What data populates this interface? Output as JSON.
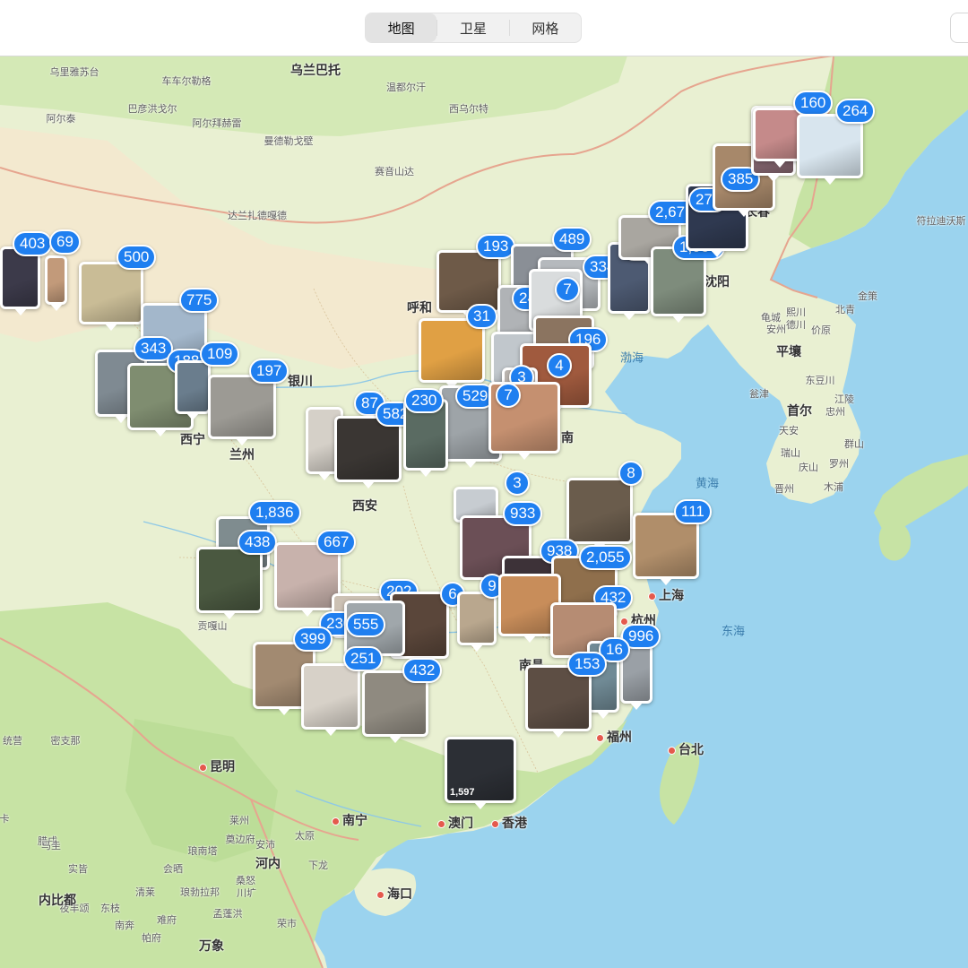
{
  "toolbar": {
    "segments": [
      "地图",
      "卫星",
      "网格"
    ],
    "active_segment": "地图"
  },
  "colors": {
    "land": "#e9f0d2",
    "forest": "#c7e3a4",
    "desert": "#f3e9cf",
    "water": "#9bd3ee",
    "border": "#e6a58f",
    "badge": "#1f7ff0",
    "city_dot": "#e45a4d"
  },
  "map_labels": [
    {
      "text": "乌里雅苏台",
      "type": "town"
    },
    {
      "text": "乌兰巴托",
      "type": "city"
    },
    {
      "text": "车车尔勒格",
      "type": "town"
    },
    {
      "text": "温都尔汗",
      "type": "town"
    },
    {
      "text": "巴彦洪戈尔",
      "type": "town"
    },
    {
      "text": "西乌尔特",
      "type": "town"
    },
    {
      "text": "阿尔泰",
      "type": "town"
    },
    {
      "text": "阿尔拜赫雷",
      "type": "town"
    },
    {
      "text": "曼德勒戈壁",
      "type": "town"
    },
    {
      "text": "赛音山达",
      "type": "town"
    },
    {
      "text": "达兰扎德嘎德",
      "type": "town"
    },
    {
      "text": "符拉迪沃斯",
      "type": "town"
    },
    {
      "text": "呼和",
      "type": "city"
    },
    {
      "text": "银川",
      "type": "city"
    },
    {
      "text": "西宁",
      "type": "city"
    },
    {
      "text": "兰州",
      "type": "city"
    },
    {
      "text": "西安",
      "type": "city"
    },
    {
      "text": "贡嘎山",
      "type": "town"
    },
    {
      "text": "昆明",
      "type": "city"
    },
    {
      "text": "南宁",
      "type": "city"
    },
    {
      "text": "澳门",
      "type": "city"
    },
    {
      "text": "香港",
      "type": "city"
    },
    {
      "text": "海口",
      "type": "city"
    },
    {
      "text": "上海",
      "type": "city"
    },
    {
      "text": "杭州",
      "type": "city"
    },
    {
      "text": "福州",
      "type": "city"
    },
    {
      "text": "台北",
      "type": "city"
    },
    {
      "text": "南",
      "type": "city"
    },
    {
      "text": "南昌",
      "type": "city"
    },
    {
      "text": "沈阳",
      "type": "city"
    },
    {
      "text": "长春",
      "type": "city"
    },
    {
      "text": "渤海",
      "type": "sea"
    },
    {
      "text": "黄海",
      "type": "sea"
    },
    {
      "text": "东海",
      "type": "sea"
    },
    {
      "text": "平壤",
      "type": "city"
    },
    {
      "text": "首尔",
      "type": "city"
    },
    {
      "text": "金策",
      "type": "town"
    },
    {
      "text": "北青",
      "type": "town"
    },
    {
      "text": "龟城",
      "type": "town"
    },
    {
      "text": "熙川",
      "type": "town"
    },
    {
      "text": "德川",
      "type": "town"
    },
    {
      "text": "安州",
      "type": "town"
    },
    {
      "text": "价原",
      "type": "town"
    },
    {
      "text": "东豆川",
      "type": "town"
    },
    {
      "text": "瓮津",
      "type": "town"
    },
    {
      "text": "江陵",
      "type": "town"
    },
    {
      "text": "忠州",
      "type": "town"
    },
    {
      "text": "天安",
      "type": "town"
    },
    {
      "text": "瑞山",
      "type": "town"
    },
    {
      "text": "群山",
      "type": "town"
    },
    {
      "text": "庆山",
      "type": "town"
    },
    {
      "text": "罗州",
      "type": "town"
    },
    {
      "text": "晋州",
      "type": "town"
    },
    {
      "text": "木浦",
      "type": "town"
    },
    {
      "text": "统营",
      "type": "town"
    },
    {
      "text": "密支那",
      "type": "town"
    },
    {
      "text": "莱州",
      "type": "town"
    },
    {
      "text": "奠边府",
      "type": "town"
    },
    {
      "text": "安沛",
      "type": "town"
    },
    {
      "text": "太原",
      "type": "town"
    },
    {
      "text": "琅南塔",
      "type": "town"
    },
    {
      "text": "河内",
      "type": "city"
    },
    {
      "text": "下龙",
      "type": "town"
    },
    {
      "text": "会晒",
      "type": "town"
    },
    {
      "text": "桑怒",
      "type": "town"
    },
    {
      "text": "清莱",
      "type": "town"
    },
    {
      "text": "琅勃拉邦",
      "type": "town"
    },
    {
      "text": "川圹",
      "type": "town"
    },
    {
      "text": "孟蓬洪",
      "type": "town"
    },
    {
      "text": "夜丰颂",
      "type": "town"
    },
    {
      "text": "南奔",
      "type": "town"
    },
    {
      "text": "难府",
      "type": "town"
    },
    {
      "text": "帕府",
      "type": "town"
    },
    {
      "text": "万象",
      "type": "city"
    },
    {
      "text": "荣市",
      "type": "town"
    },
    {
      "text": "内比都",
      "type": "city"
    },
    {
      "text": "东枝",
      "type": "town"
    },
    {
      "text": "腊戌",
      "type": "town"
    },
    {
      "text": "实皆",
      "type": "town"
    },
    {
      "text": "马圭",
      "type": "town"
    },
    {
      "text": "卡",
      "type": "town"
    }
  ],
  "photo_clusters": [
    {
      "count": "403",
      "color": "#3c3a4a"
    },
    {
      "count": "69",
      "color": "#c29a7a"
    },
    {
      "count": "500",
      "color": "#c9bc96"
    },
    {
      "count": "775",
      "color": "#a3b7cb"
    },
    {
      "count": "343",
      "color": "#7f8a92"
    },
    {
      "count": "188",
      "color": "#7f8d70"
    },
    {
      "count": "109",
      "color": "#6a7d8d"
    },
    {
      "count": "197",
      "color": "#9c9a94"
    },
    {
      "count": "193",
      "color": "#6e5a48"
    },
    {
      "count": "489",
      "color": "#8a8f96"
    },
    {
      "count": "334",
      "color": "#b5b9bd"
    },
    {
      "count": "643",
      "color": "#4d5a72"
    },
    {
      "count": "2,676",
      "color": "#a9a6a0"
    },
    {
      "count": "1,067",
      "color": "#7e8c7c"
    },
    {
      "count": "279",
      "color": "#2f3950"
    },
    {
      "count": "385",
      "color": "#a7886a"
    },
    {
      "count": "3",
      "color": "#8a6a74"
    },
    {
      "count": "160",
      "color": "#c58a8a"
    },
    {
      "count": "264",
      "color": "#d8e5ee"
    },
    {
      "count": "24",
      "color": "#b0b3b6"
    },
    {
      "count": "7",
      "color": "#d9dcdd"
    },
    {
      "count": "31",
      "color": "#e0a044"
    },
    {
      "count": "5",
      "color": "#c1c7cc"
    },
    {
      "count": "196",
      "color": "#8b7460"
    },
    {
      "count": "4",
      "color": "#a05a3e"
    },
    {
      "count": "3",
      "color": "#b8b2ad"
    },
    {
      "count": "529",
      "color": "#9ea4a8"
    },
    {
      "count": "7",
      "color": "#c59070"
    },
    {
      "count": "87",
      "color": "#d5d0c8"
    },
    {
      "count": "582",
      "color": "#3a3633"
    },
    {
      "count": "230",
      "color": "#5a6b62"
    },
    {
      "count": "1,836",
      "color": "#7f8c8f"
    },
    {
      "count": "438",
      "color": "#4a5840"
    },
    {
      "count": "667",
      "color": "#c8b2ac"
    },
    {
      "count": "3",
      "color": "#c7ccd1"
    },
    {
      "count": "933",
      "color": "#6b4f56"
    },
    {
      "count": "8",
      "color": "#6a5c4c"
    },
    {
      "count": "111",
      "color": "#b08e6a"
    },
    {
      "count": "938",
      "color": "#3d3238"
    },
    {
      "count": "2,055",
      "color": "#8f6f4c"
    },
    {
      "count": "202",
      "color": "#ccc1b4"
    },
    {
      "count": "6",
      "color": "#5a463a"
    },
    {
      "count": "9",
      "color": "#b9a78e"
    },
    {
      "count": "432",
      "color": "#c88d5a"
    },
    {
      "count": "230",
      "color": "#b68c73"
    },
    {
      "count": "555",
      "color": "#a0a7ab"
    },
    {
      "count": "399",
      "color": "#a28a71"
    },
    {
      "count": "251",
      "color": "#d7d1c8"
    },
    {
      "count": "432",
      "color": "#8f8a80"
    },
    {
      "count": "996",
      "color": "#9aa0a6"
    },
    {
      "count": "16",
      "color": "#708a95"
    },
    {
      "count": "153",
      "color": "#5d4e44"
    },
    {
      "count": "1,597",
      "color": "#2c2f35"
    }
  ]
}
